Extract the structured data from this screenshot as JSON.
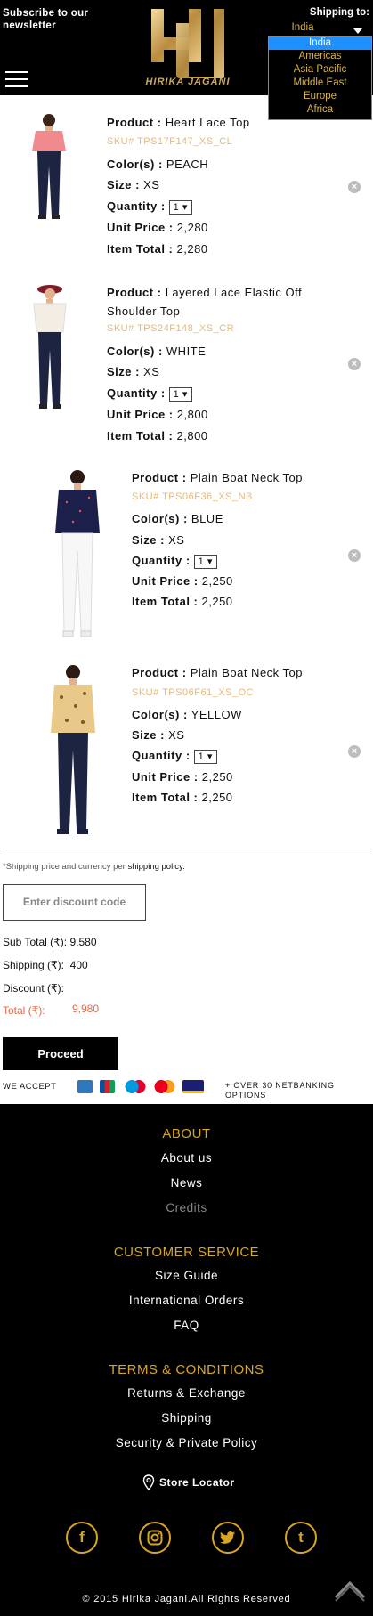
{
  "header": {
    "subscribe": "Subscribe to our newsletter",
    "brand": "HIRIKA JAGANI",
    "shipping_label": "Shipping to:",
    "shipping_selected": "India",
    "shipping_options": [
      "India",
      "Americas",
      "Asia Pacific",
      "Middle East",
      "Europe",
      "Africa"
    ]
  },
  "labels": {
    "product": "Product :",
    "color": "Color(s) :",
    "size": "Size :",
    "quantity": "Quantity :",
    "unit_price": "Unit Price :",
    "item_total": "Item Total :"
  },
  "items": [
    {
      "product": "Heart Lace Top",
      "sku": "SKU# TPS17F147_XS_CL",
      "color": "PEACH",
      "size": "XS",
      "qty": "1",
      "unit_price": "2,280",
      "item_total": "2,280"
    },
    {
      "product": "Layered Lace Elastic Off Shoulder Top",
      "sku": "SKU# TPS24F148_XS_CR",
      "color": "WHITE",
      "size": "XS",
      "qty": "1",
      "unit_price": "2,800",
      "item_total": "2,800"
    },
    {
      "product": "Plain Boat Neck Top",
      "sku": "SKU# TPS06F36_XS_NB",
      "color": "BLUE",
      "size": "XS",
      "qty": "1",
      "unit_price": "2,250",
      "item_total": "2,250"
    },
    {
      "product": "Plain Boat Neck Top",
      "sku": "SKU# TPS06F61_XS_OC",
      "color": "YELLOW",
      "size": "XS",
      "qty": "1",
      "unit_price": "2,250",
      "item_total": "2,250"
    }
  ],
  "summary": {
    "shipping_note": "*Shipping price and currency per",
    "shipping_policy_link": "shipping policy.",
    "discount_placeholder": "Enter discount code",
    "sub_total_label": "Sub Total (₹):",
    "sub_total": "9,580",
    "shipping_label": "Shipping (₹):",
    "shipping": "400",
    "discount_label": "Discount (₹):",
    "discount": "",
    "total_label": "Total (₹):",
    "total": "9,980",
    "proceed": "Proceed",
    "we_accept": "WE ACCEPT",
    "cards": [
      "amex",
      "jcb",
      "maestro",
      "mastercard",
      "visa"
    ],
    "netbanking": "+ OVER 30 NETBANKING OPTIONS"
  },
  "footer": {
    "about_heading": "ABOUT",
    "about_links": [
      "About us",
      "News",
      "Credits"
    ],
    "service_heading": "CUSTOMER SERVICE",
    "service_links": [
      "Size Guide",
      "International Orders",
      "FAQ"
    ],
    "terms_heading": "TERMS & CONDITIONS",
    "terms_links": [
      "Returns & Exchange",
      "Shipping",
      "Security & Private Policy"
    ],
    "store_locator": "Store Locator",
    "social": [
      "facebook",
      "instagram",
      "twitter",
      "tumblr"
    ],
    "copyright": "© 2015 Hirika Jagani.All Rights Reserved"
  },
  "colors": {
    "gold": "#d8a621",
    "sku": "#e5b97a",
    "total_red": "#e26b4a",
    "dropdown_highlight": "#1e90ff"
  }
}
